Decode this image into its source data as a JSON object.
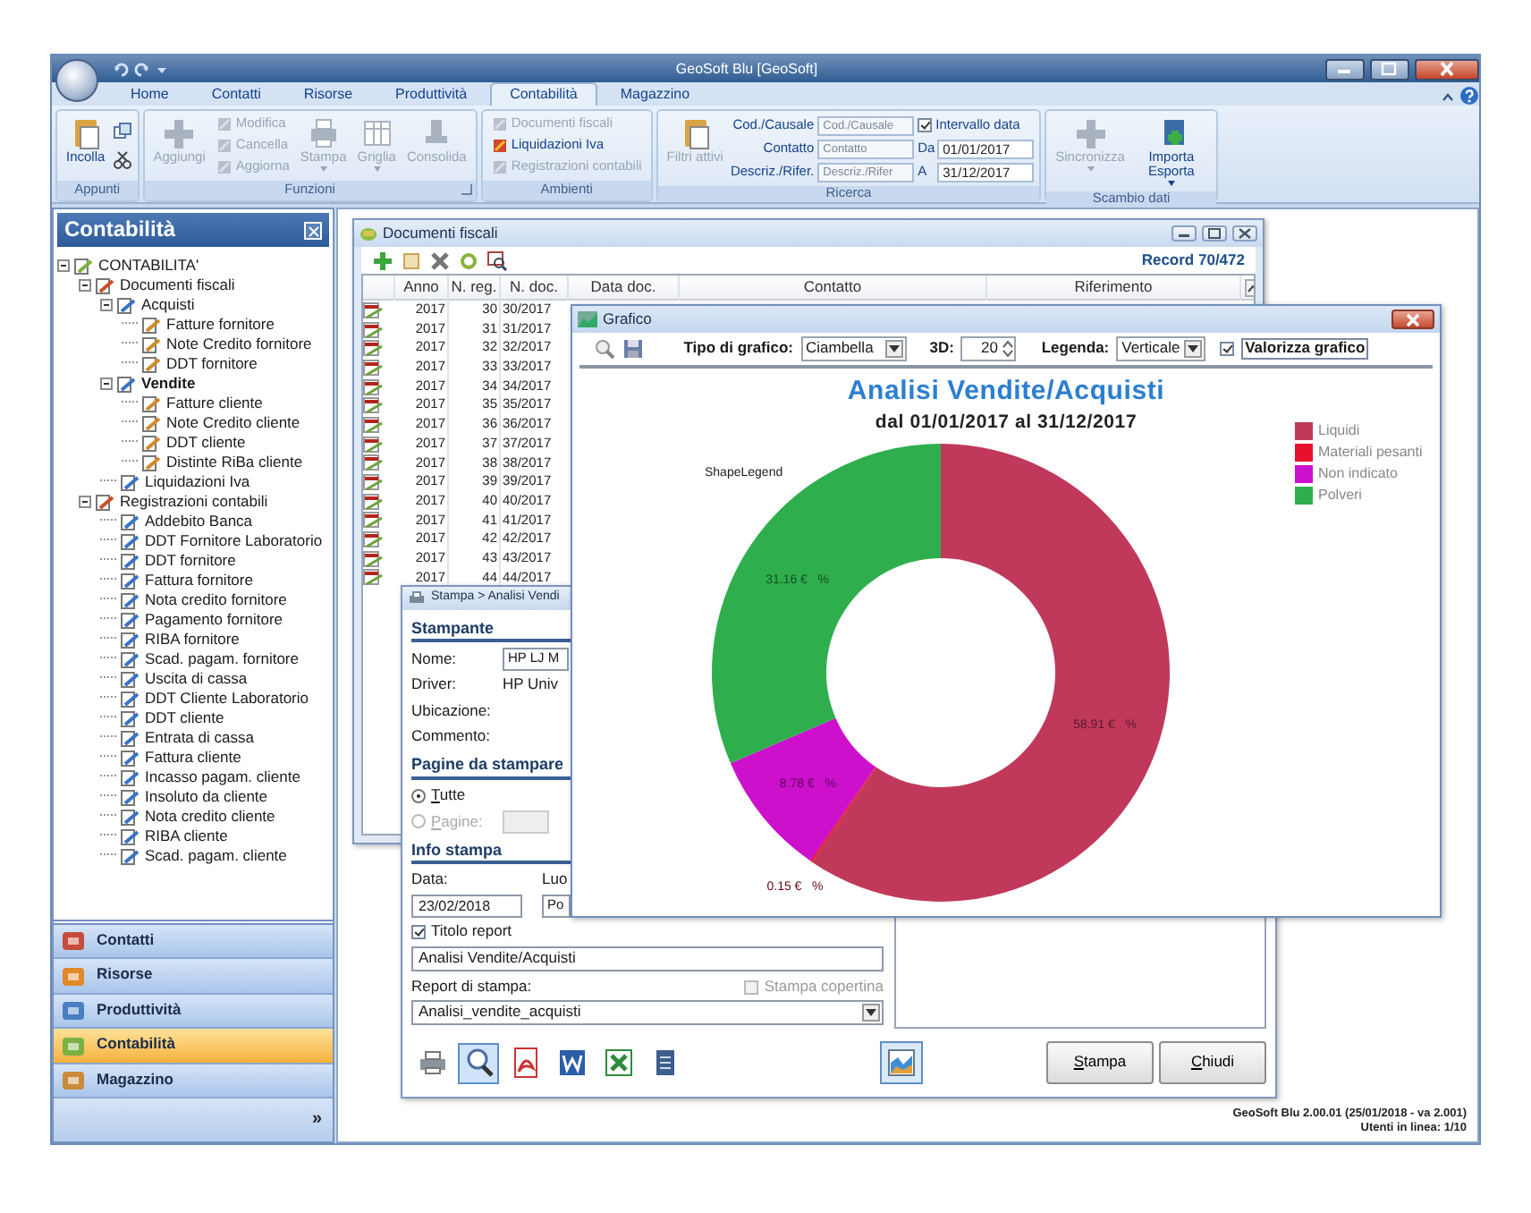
{
  "window": {
    "title": "GeoSoft Blu [GeoSoft]"
  },
  "ribbon_tabs": [
    {
      "label": "Home",
      "selected": false
    },
    {
      "label": "Contatti",
      "selected": false
    },
    {
      "label": "Risorse",
      "selected": false
    },
    {
      "label": "Produttività",
      "selected": false
    },
    {
      "label": "Contabilità",
      "selected": true
    },
    {
      "label": "Magazzino",
      "selected": false
    }
  ],
  "ribbon_groups": [
    {
      "label": "Appunti",
      "items": [
        {
          "kind": "large",
          "label": "Incolla",
          "disabled": false
        },
        {
          "kind": "icon",
          "disabled": false
        },
        {
          "kind": "icon",
          "disabled": false
        }
      ]
    },
    {
      "label": "Funzioni",
      "launcher": true,
      "items": [
        {
          "kind": "large",
          "label": "Aggiungi",
          "disabled": true
        },
        {
          "kind": "small",
          "label": "Modifica",
          "disabled": true
        },
        {
          "kind": "small",
          "label": "Cancella",
          "disabled": true
        },
        {
          "kind": "small",
          "label": "Aggiorna",
          "disabled": true
        },
        {
          "kind": "large",
          "label": "Stampa",
          "disabled": true,
          "dropdown": true
        },
        {
          "kind": "large",
          "label": "Griglia",
          "disabled": true,
          "dropdown": true
        },
        {
          "kind": "large",
          "label": "Consolida",
          "disabled": true
        }
      ]
    },
    {
      "label": "Ambienti",
      "items": [
        {
          "kind": "small",
          "label": "Documenti fiscali",
          "disabled": true
        },
        {
          "kind": "small",
          "label": "Liquidazioni Iva",
          "disabled": false
        },
        {
          "kind": "small",
          "label": "Registrazioni contabili",
          "disabled": true
        }
      ]
    },
    {
      "label": "Ricerca",
      "items": [
        {
          "kind": "large",
          "label": "Filtri attivi",
          "disabled": true
        }
      ],
      "search_fields": [
        {
          "label": "Cod./Causale",
          "placeholder": "Cod./Causale"
        },
        {
          "label": "Contatto",
          "placeholder": "Contatto"
        },
        {
          "label": "Descriz./Rifer.",
          "placeholder": "Descriz./Rifer"
        }
      ],
      "date_filter": {
        "label": "Intervallo data",
        "checked": true,
        "from_label": "Da",
        "from_value": "01/01/2017",
        "to_label": "A",
        "to_value": "31/12/2017"
      }
    },
    {
      "label": "Scambio dati",
      "items": [
        {
          "kind": "large",
          "label": "Sincronizza",
          "disabled": true,
          "dropdown": true
        },
        {
          "kind": "large",
          "label": "Importa Esporta",
          "disabled": false,
          "dropdown": true
        }
      ]
    }
  ],
  "sidebar": {
    "title": "Contabilità",
    "tree": [
      {
        "label": "CONTABILITA'",
        "expanded": true,
        "selected": false,
        "children": [
          {
            "label": "Documenti fiscali",
            "expanded": true,
            "selected": false,
            "children": [
              {
                "label": "Acquisti",
                "expanded": true,
                "selected": false,
                "children": [
                  {
                    "label": "Fatture fornitore",
                    "selected": false
                  },
                  {
                    "label": "Note Credito fornitore",
                    "selected": false
                  },
                  {
                    "label": "DDT fornitore",
                    "selected": false
                  }
                ]
              },
              {
                "label": "Vendite",
                "expanded": true,
                "selected": true,
                "children": [
                  {
                    "label": "Fatture cliente",
                    "selected": false
                  },
                  {
                    "label": "Note Credito cliente",
                    "selected": false
                  },
                  {
                    "label": "DDT cliente",
                    "selected": false
                  },
                  {
                    "label": "Distinte RiBa cliente",
                    "selected": false
                  }
                ]
              },
              {
                "label": "Liquidazioni Iva",
                "selected": false
              }
            ]
          },
          {
            "label": "Registrazioni contabili",
            "expanded": true,
            "selected": false,
            "children": [
              {
                "label": "Addebito Banca",
                "selected": false
              },
              {
                "label": "DDT Fornitore Laboratorio",
                "selected": false
              },
              {
                "label": "DDT fornitore",
                "selected": false
              },
              {
                "label": "Fattura fornitore",
                "selected": false
              },
              {
                "label": "Nota credito fornitore",
                "selected": false
              },
              {
                "label": "Pagamento fornitore",
                "selected": false
              },
              {
                "label": "RIBA fornitore",
                "selected": false
              },
              {
                "label": "Scad. pagam. fornitore",
                "selected": false
              },
              {
                "label": "Uscita di cassa",
                "selected": false
              },
              {
                "label": "DDT Cliente Laboratorio",
                "selected": false
              },
              {
                "label": "DDT cliente",
                "selected": false
              },
              {
                "label": "Entrata di cassa",
                "selected": false
              },
              {
                "label": "Fattura cliente",
                "selected": false
              },
              {
                "label": "Incasso pagam. cliente",
                "selected": false
              },
              {
                "label": "Insoluto da cliente",
                "selected": false
              },
              {
                "label": "Nota credito cliente",
                "selected": false
              },
              {
                "label": "RIBA cliente",
                "selected": false
              },
              {
                "label": "Scad. pagam. cliente",
                "selected": false
              }
            ]
          }
        ]
      }
    ],
    "nav": [
      {
        "label": "Contatti",
        "selected": false
      },
      {
        "label": "Risorse",
        "selected": false
      },
      {
        "label": "Produttività",
        "selected": false
      },
      {
        "label": "Contabilità",
        "selected": true
      },
      {
        "label": "Magazzino",
        "selected": false
      }
    ],
    "more": "»"
  },
  "documents_window": {
    "title": "Documenti fiscali",
    "record": "Record 70/472",
    "columns": [
      "Anno",
      "N. reg.",
      "N. doc.",
      "Data doc.",
      "Contatto",
      "Riferimento"
    ],
    "rows": [
      [
        "2017",
        "30",
        "30/2017"
      ],
      [
        "2017",
        "31",
        "31/2017"
      ],
      [
        "2017",
        "32",
        "32/2017"
      ],
      [
        "2017",
        "33",
        "33/2017"
      ],
      [
        "2017",
        "34",
        "34/2017"
      ],
      [
        "2017",
        "35",
        "35/2017"
      ],
      [
        "2017",
        "36",
        "36/2017"
      ],
      [
        "2017",
        "37",
        "37/2017"
      ],
      [
        "2017",
        "38",
        "38/2017"
      ],
      [
        "2017",
        "39",
        "39/2017"
      ],
      [
        "2017",
        "40",
        "40/2017"
      ],
      [
        "2017",
        "41",
        "41/2017"
      ],
      [
        "2017",
        "42",
        "42/2017"
      ],
      [
        "2017",
        "43",
        "43/2017"
      ],
      [
        "2017",
        "44",
        "44/2017"
      ]
    ]
  },
  "print_dialog": {
    "title": "Stampa > Analisi Vendi",
    "printer_section": "Stampante",
    "printer_fields": [
      {
        "kind": "input",
        "label": "Nome:",
        "value": "HP LJ M"
      },
      {
        "kind": "text",
        "label": "Driver:",
        "value": "HP Univ"
      },
      {
        "kind": "text",
        "label": "Ubicazione:"
      },
      {
        "kind": "text",
        "label": "Commento:"
      }
    ],
    "pages_section": "Pagine da stampare",
    "page_options": [
      {
        "label": "Tutte",
        "selected": true,
        "disabled": false
      },
      {
        "label": "Pagine:",
        "selected": false,
        "disabled": true
      }
    ],
    "info_section": "Info stampa",
    "date_label": "Data:",
    "date_value": "23/02/2018",
    "place_label": "Luo",
    "place_value": "Po",
    "title_check": {
      "label": "Titolo report",
      "checked": true
    },
    "title_value": "Analisi Vendite/Acquisti",
    "report_label": "Report di stampa:",
    "cover_check": {
      "label": "Stampa copertina",
      "checked": false,
      "disabled": true
    },
    "report_value": "Analisi_vendite_acquisti",
    "outputs": [
      {
        "selected": false
      },
      {
        "selected": true
      },
      {
        "selected": false
      },
      {
        "selected": false
      },
      {
        "selected": false
      },
      {
        "selected": false
      }
    ],
    "buttons": [
      "Stampa",
      "Chiudi"
    ]
  },
  "chart_window": {
    "title": "Grafico",
    "type_label": "Tipo di grafico:",
    "type_value": "Ciambella",
    "depth_label": "3D:",
    "depth_value": "20",
    "legend_label": "Legenda:",
    "legend_value": "Verticale",
    "values_check": {
      "label": "Valorizza grafico",
      "checked": true
    },
    "subtitle": "dal 01/01/2017 al 31/12/2017",
    "shape_legend": "ShapeLegend",
    "chart_data": {
      "type": "donut",
      "title": "Analisi Vendite/Acquisti",
      "legend": "right",
      "categories": [
        "Liquidi",
        "Materiali pesanti",
        "Non indicato",
        "Polveri"
      ],
      "values": [
        58.91,
        0.15,
        8.78,
        31.16
      ],
      "colors": [
        "#c0395a",
        "#e8102a",
        "#cc10cc",
        "#2fae4e"
      ],
      "value_labels": [
        "58.91 €   %",
        "0.15 €   %",
        "8.78 €   %",
        "31.16 €   %"
      ]
    }
  },
  "status": {
    "version": "GeoSoft Blu 2.00.01 (25/01/2018 - va 2.001)",
    "users": "Utenti in linea: 1/10"
  }
}
